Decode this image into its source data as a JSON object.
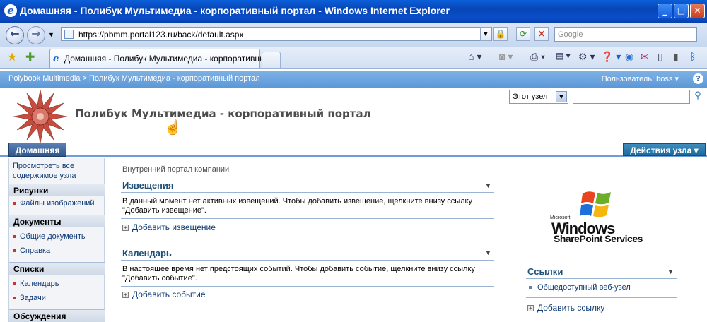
{
  "window": {
    "title": "Домашняя - Полибук Мультимедиа - корпоративный портал - Windows Internet Explorer",
    "minimize": "_",
    "maximize": "□",
    "close": "✕"
  },
  "address_bar": {
    "url": "https://pbmm.portal123.ru/back/default.aspx",
    "search_placeholder": "Google"
  },
  "tabs": [
    {
      "label": "Домашняя - Полибук Мультимедиа - корпоративны..."
    }
  ],
  "sharepoint": {
    "breadcrumb": "Polybook Multimedia > Полибук Мультимедиа - корпоративный портал",
    "user": "Пользователь: boss ▾",
    "help": "?",
    "portal_title": "Полибук Мультимедиа - корпоративный портал",
    "search_scope": "Этот узел",
    "home_tab": "Домашняя",
    "site_actions": "Действия узла ▾"
  },
  "quick_launch": {
    "view_all": "Просмотреть все содержимое узла",
    "sections": [
      {
        "title": "Рисунки",
        "items": [
          "Файлы изображений"
        ]
      },
      {
        "title": "Документы",
        "items": [
          "Общие документы",
          "Справка"
        ]
      },
      {
        "title": "Списки",
        "items": [
          "Календарь",
          "Задачи"
        ]
      },
      {
        "title": "Обсуждения",
        "items": []
      }
    ]
  },
  "main": {
    "intro": "Внутренний портал компании",
    "announcements": {
      "title": "Извещения",
      "text_line1": "В данный момент нет активных извещений. Чтобы добавить извещение, щелкните внизу ссылку",
      "text_line2": "\"Добавить извещение\".",
      "add_link": "Добавить извещение"
    },
    "calendar": {
      "title": "Календарь",
      "text_line1": "В настоящее время нет предстоящих событий. Чтобы добавить событие, щелкните внизу ссылку",
      "text_line2": "\"Добавить событие\".",
      "add_link": "Добавить событие"
    },
    "links": {
      "title": "Ссылки",
      "items": [
        "Общедоступный веб-узел"
      ],
      "add_link": "Добавить ссылку"
    },
    "logo": {
      "line1": "Microsoft",
      "line2": "Windows",
      "line3": "SharePoint Services"
    }
  }
}
